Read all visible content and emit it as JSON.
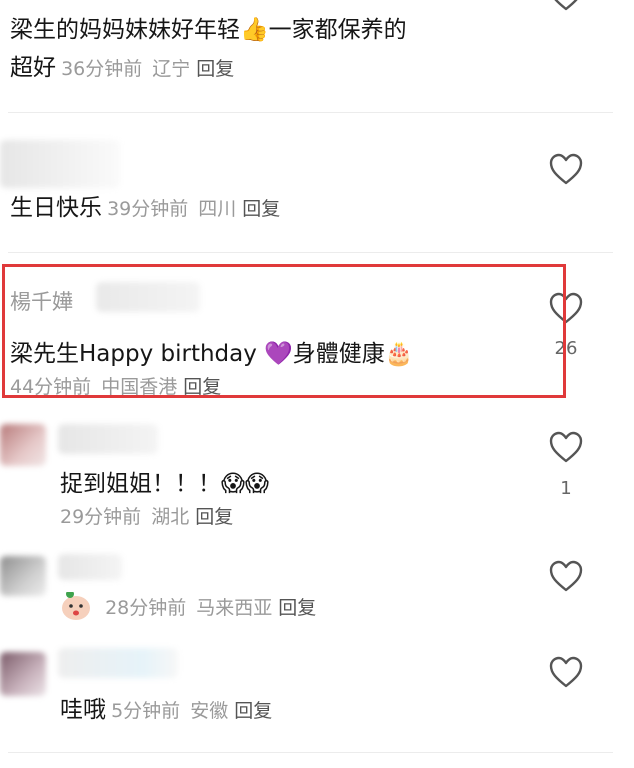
{
  "comments": [
    {
      "text_line1": "梁生的妈妈妹妹好年轻👍一家都保养的",
      "text_line2": "超好",
      "time": "36分钟前",
      "location": "辽宁",
      "reply": "回复"
    },
    {
      "text": "生日快乐",
      "time": "39分钟前",
      "location": "四川",
      "reply": "回复"
    },
    {
      "username": "楊千嬅",
      "text": "梁先生Happy birthday 💜身體健康🎂",
      "time": "44分钟前",
      "location": "中国香港",
      "reply": "回复",
      "likes": "26"
    },
    {
      "text": "捉到姐姐！！！😱😱",
      "time": "29分钟前",
      "location": "湖北",
      "reply": "回复",
      "likes": "1"
    },
    {
      "time": "28分钟前",
      "location": "马来西亚",
      "reply": "回复"
    },
    {
      "text": "哇哦",
      "time": "5分钟前",
      "location": "安徽",
      "reply": "回复"
    }
  ],
  "colors": {
    "highlight": "#e0393a",
    "meta_text": "#9a9a9a",
    "heart_stroke": "#555555"
  },
  "icons": [
    "heart-outline-icon",
    "thumbs-up-emoji",
    "purple-heart-emoji",
    "cake-emoji",
    "screaming-face-emoji"
  ]
}
